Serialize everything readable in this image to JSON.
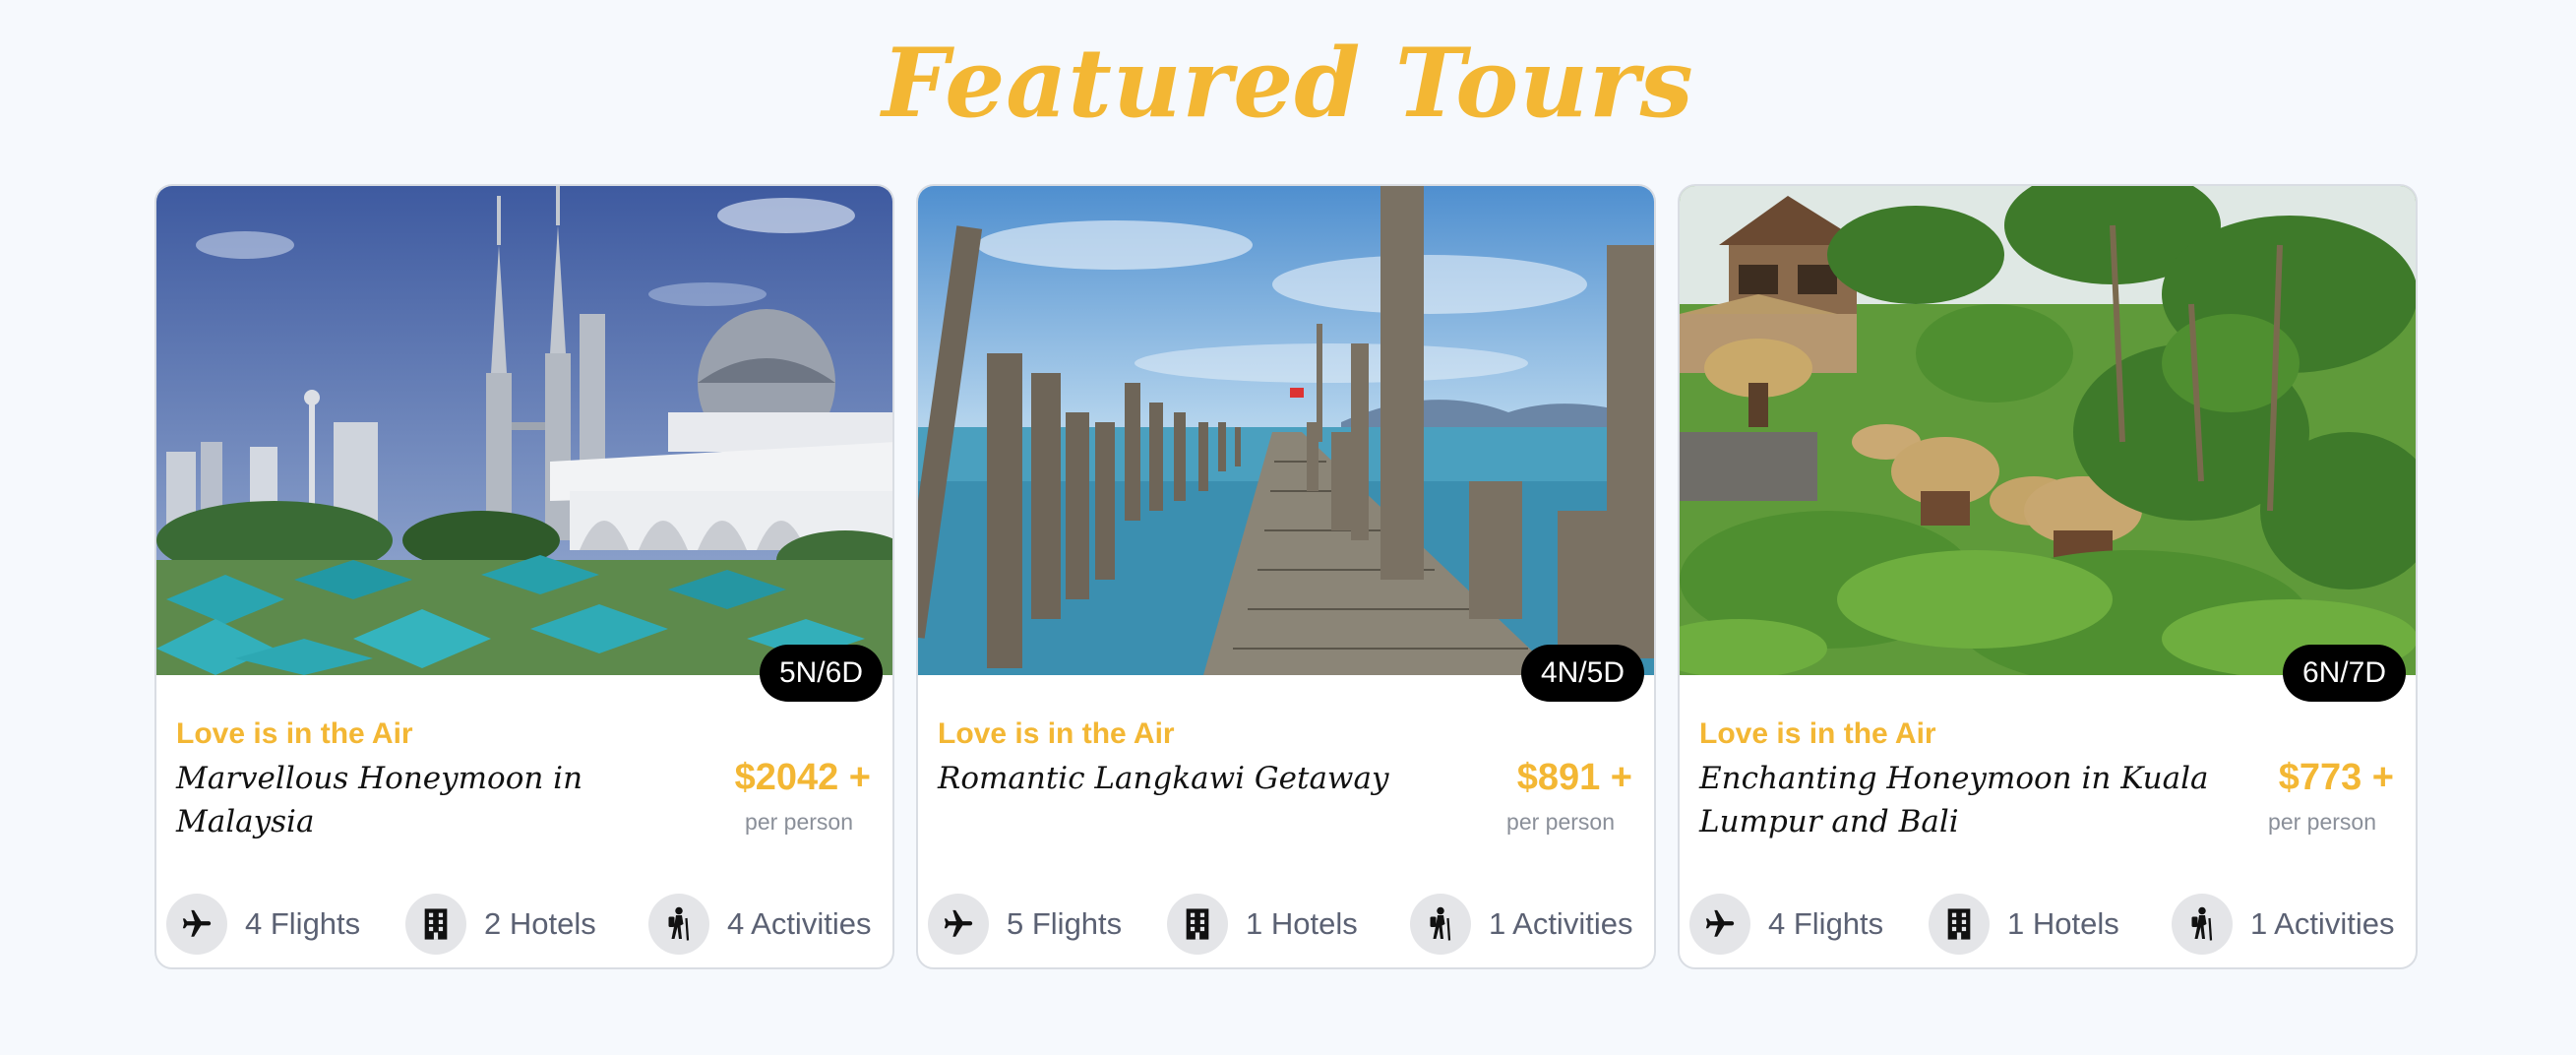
{
  "section": {
    "title": "Featured Tours"
  },
  "tours": [
    {
      "duration": "5N/6D",
      "tagline": "Love is in the Air",
      "name": "Marvellous Honeymoon in Malaysia",
      "price": "$2042 +",
      "price_unit": "per person",
      "photo": "kuala-lumpur-towers-mosque-photo",
      "features": [
        {
          "icon": "airplane-icon",
          "label": "4 Flights"
        },
        {
          "icon": "building-icon",
          "label": "2 Hotels"
        },
        {
          "icon": "hiker-icon",
          "label": "4 Activities"
        }
      ]
    },
    {
      "duration": "4N/5D",
      "tagline": "Love is in the Air",
      "name": "Romantic Langkawi Getaway",
      "price": "$891 +",
      "price_unit": "per person",
      "photo": "wooden-pier-sea-photo",
      "features": [
        {
          "icon": "airplane-icon",
          "label": "5 Flights"
        },
        {
          "icon": "building-icon",
          "label": "1 Hotels"
        },
        {
          "icon": "hiker-icon",
          "label": "1 Activities"
        }
      ]
    },
    {
      "duration": "6N/7D",
      "tagline": "Love is in the Air",
      "name": "Enchanting Honeymoon in Kuala Lumpur and Bali",
      "price": "$773 +",
      "price_unit": "per person",
      "photo": "bali-jungle-huts-photo",
      "features": [
        {
          "icon": "airplane-icon",
          "label": "4 Flights"
        },
        {
          "icon": "building-icon",
          "label": "1 Hotels"
        },
        {
          "icon": "hiker-icon",
          "label": "1 Activities"
        }
      ]
    }
  ],
  "colors": {
    "accent": "#f3b734",
    "page_background": "#f6f9fd",
    "badge_background": "#000000",
    "feature_text": "#5b6173",
    "icon_circle": "#e4e5e8"
  }
}
